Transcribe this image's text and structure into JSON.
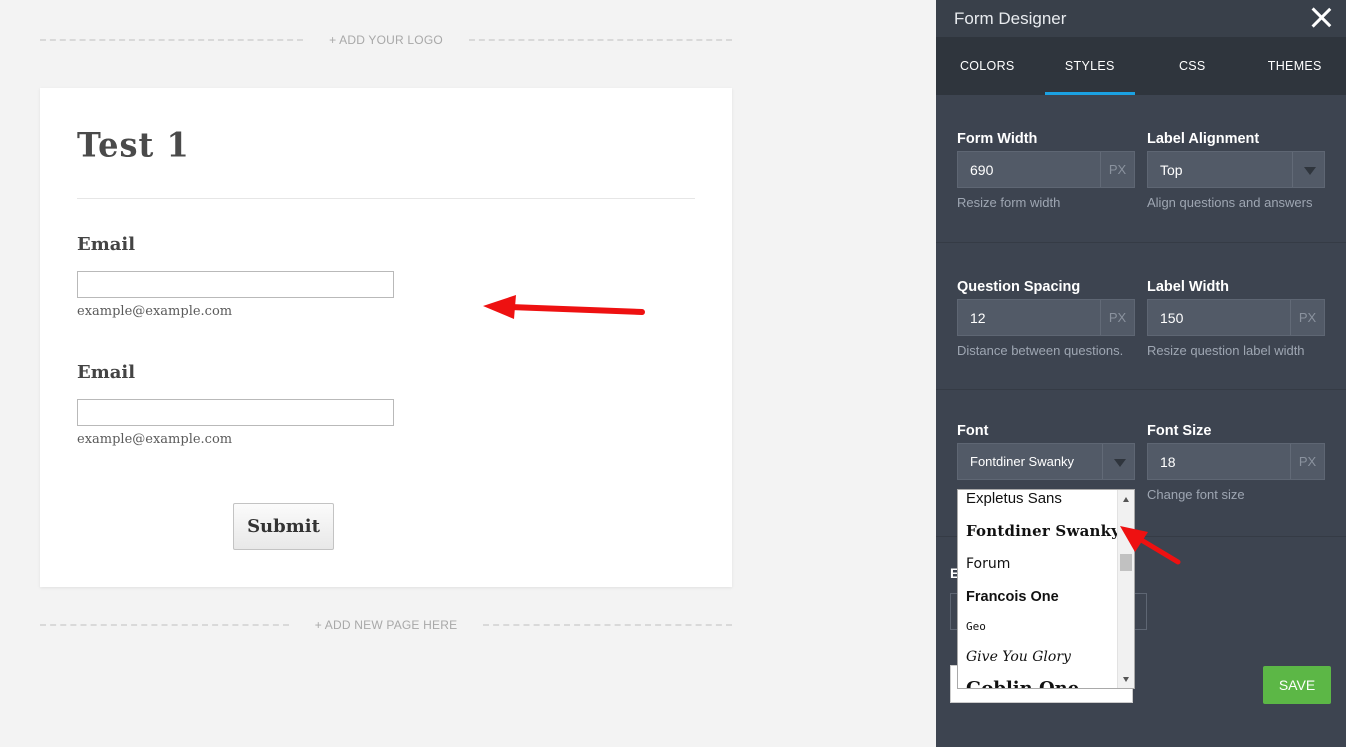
{
  "canvas": {
    "add_logo": "+ ADD YOUR LOGO",
    "add_page": "+ ADD NEW PAGE HERE",
    "form_title": "Test 1",
    "questions": [
      {
        "label": "Email",
        "sublabel": "example@example.com",
        "value": ""
      },
      {
        "label": "Email",
        "sublabel": "example@example.com",
        "value": ""
      }
    ],
    "submit_label": "Submit"
  },
  "designer": {
    "title": "Form Designer",
    "tabs": [
      "COLORS",
      "STYLES",
      "CSS",
      "THEMES"
    ],
    "active_tab": "STYLES",
    "accent_color": "#1ba1e2",
    "form_width": {
      "label": "Form Width",
      "value": "690",
      "unit": "PX",
      "hint": "Resize form width"
    },
    "label_alignment": {
      "label": "Label Alignment",
      "value": "Top",
      "hint": "Align questions and answers"
    },
    "question_spacing": {
      "label": "Question Spacing",
      "value": "12",
      "unit": "PX",
      "hint": "Distance between questions."
    },
    "label_width": {
      "label": "Label Width",
      "value": "150",
      "unit": "PX",
      "hint": "Resize question label width"
    },
    "font": {
      "label": "Font",
      "value": "Fontdiner Swanky"
    },
    "font_size": {
      "label": "Font Size",
      "value": "18",
      "unit": "PX",
      "hint": "Change font size"
    },
    "font_options": [
      "Expletus Sans",
      "Fontdiner Swanky",
      "Forum",
      "Francois One",
      "Geo",
      "Give You Glory",
      "Goblin One"
    ],
    "hidden_label_initial": "E",
    "save_label": "SAVE",
    "save_color": "#5cb746"
  }
}
